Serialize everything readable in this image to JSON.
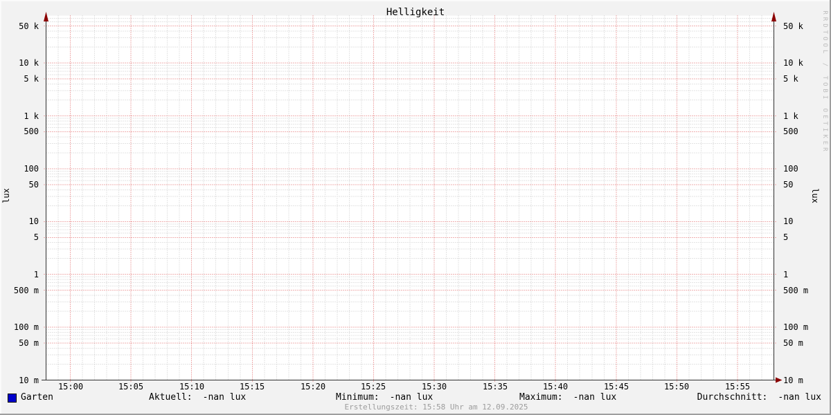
{
  "chart_data": {
    "type": "line",
    "title": "Helligkeit",
    "ylabel": "lux",
    "yscale": "log",
    "ylim": [
      0.01,
      80000
    ],
    "grid_on": true,
    "legend_position": "bottom",
    "x_ticks": [
      "15:00",
      "15:05",
      "15:10",
      "15:15",
      "15:20",
      "15:25",
      "15:30",
      "15:35",
      "15:40",
      "15:45",
      "15:50",
      "15:55"
    ],
    "y_ticks": [
      {
        "value": 50000,
        "label": "50 k"
      },
      {
        "value": 10000,
        "label": "10 k"
      },
      {
        "value": 5000,
        "label": "5 k"
      },
      {
        "value": 1000,
        "label": "1 k"
      },
      {
        "value": 500,
        "label": "500"
      },
      {
        "value": 100,
        "label": "100"
      },
      {
        "value": 50,
        "label": "50"
      },
      {
        "value": 10,
        "label": "10"
      },
      {
        "value": 5,
        "label": "5"
      },
      {
        "value": 1,
        "label": "1"
      },
      {
        "value": 0.5,
        "label": "500 m"
      },
      {
        "value": 0.1,
        "label": "100 m"
      },
      {
        "value": 0.05,
        "label": "50 m"
      },
      {
        "value": 0.01,
        "label": "10 m"
      }
    ],
    "series": [
      {
        "name": "Garten",
        "color": "#0000cc",
        "values": []
      }
    ],
    "no_data": true,
    "stats": [
      {
        "label": "Aktuell:",
        "value": "-nan lux"
      },
      {
        "label": "Minimum:",
        "value": "-nan lux"
      },
      {
        "label": "Maximum:",
        "value": "-nan lux"
      },
      {
        "label": "Durchschnitt:",
        "value": "-nan lux"
      }
    ],
    "colors": {
      "background": "#f2f2f2",
      "canvas": "#ffffff",
      "minor_grid": "#c8c8c8",
      "major_grid": "#e06060",
      "axis": "#2f2f2f",
      "arrow": "#8b0000"
    }
  },
  "footer": {
    "creation_text": "Erstellungszeit: 15:58 Uhr am 12.09.2025"
  },
  "watermark": "RRDTOOL / TOBI OETIKER"
}
